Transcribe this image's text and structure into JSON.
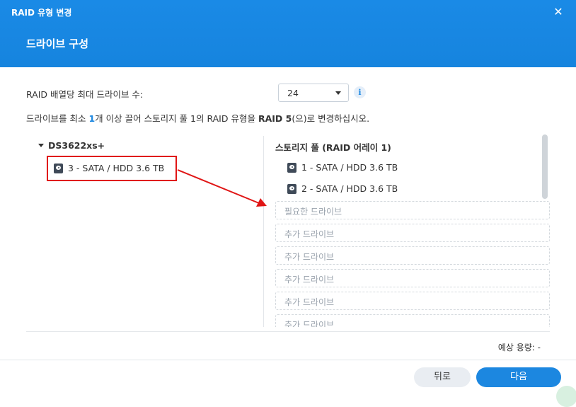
{
  "window": {
    "title": "RAID 유형 변경",
    "close_symbol": "✕"
  },
  "step": {
    "title": "드라이브 구성"
  },
  "max_drives": {
    "label": "RAID 배열당 최대 드라이브 수:",
    "selected_value": "24",
    "info_symbol": "i"
  },
  "description": {
    "part1": "드라이브를 최소 ",
    "count": "1",
    "part2": "개 이상 끌어 스토리지 풀 1의 RAID 유형을 ",
    "raid": "RAID 5",
    "part3": "(으)로 변경하십시오."
  },
  "source": {
    "server_name": "DS3622xs+",
    "drives": [
      {
        "label": "3 - SATA / HDD 3.6 TB"
      }
    ]
  },
  "pool": {
    "title": "스토리지 풀 (RAID 어레이 1)",
    "drives": [
      {
        "label": "1 - SATA / HDD 3.6 TB"
      },
      {
        "label": "2 - SATA / HDD 3.6 TB"
      }
    ],
    "slots": [
      {
        "label": "필요한 드라이브"
      },
      {
        "label": "추가 드라이브"
      },
      {
        "label": "추가 드라이브"
      },
      {
        "label": "추가 드라이브"
      },
      {
        "label": "추가 드라이브"
      },
      {
        "label": "추가 드라이브"
      }
    ]
  },
  "capacity": {
    "label": "예상 용량: -"
  },
  "buttons": {
    "back": "뒤로",
    "next": "다음"
  },
  "colors": {
    "header": "#1a8ae6",
    "accent": "#1c87e0",
    "highlight": "#e01515"
  }
}
